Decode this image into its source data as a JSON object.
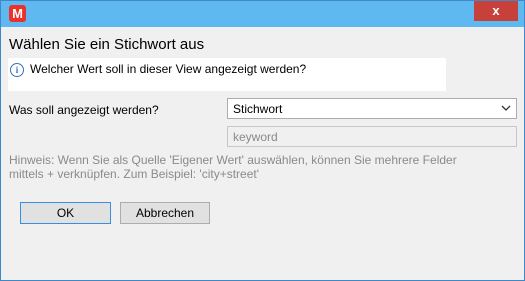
{
  "window": {
    "app_icon_letter": "M",
    "close_symbol": "x"
  },
  "dialog": {
    "title": "Wählen Sie ein Stichwort aus",
    "info_text": "Welcher Wert soll in dieser View angezeigt werden?",
    "field_label": "Was soll angezeigt werden?",
    "select_value": "Stichwort",
    "keyword_placeholder": "keyword",
    "hint_line1": "Hinweis: Wenn Sie als Quelle 'Eigener Wert' auswählen, können Sie mehrere Felder",
    "hint_line2": "mittels + verknüpfen. Zum Beispiel: 'city+street'"
  },
  "buttons": {
    "ok": "OK",
    "cancel": "Abbrechen"
  },
  "colors": {
    "titlebar": "#5fb8ef",
    "close_button": "#c7403a",
    "app_icon": "#e8322b"
  }
}
